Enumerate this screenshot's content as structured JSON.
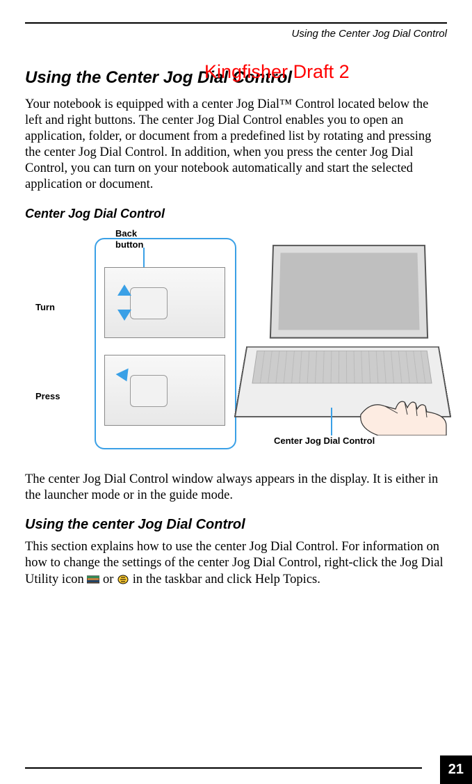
{
  "running_head": "Using the Center Jog Dial Control",
  "watermark": "Kingfisher Draft 2",
  "h1": "Using the Center Jog Dial Control",
  "p1": "Your notebook is equipped with a center Jog Dial™ Control located below the left and right buttons. The center Jog Dial Control enables you to open an application, folder, or document from a predefined list by rotating and pressing the center Jog Dial Control. In addition, when you press the center Jog Dial Control, you can turn on your notebook automatically and start the selected application or document.",
  "figcap": "Center Jog Dial Control",
  "labels": {
    "back": "Back\nbutton",
    "turn": "Turn",
    "press": "Press",
    "centerjog": "Center Jog Dial Control"
  },
  "p2": "The center Jog Dial Control window always appears in the display. It is either in the launcher mode or in the guide mode.",
  "h2": "Using the center Jog Dial Control",
  "p3a": "This section explains how to use the center Jog Dial Control. For information on how to change the settings of the center Jog Dial Control, right-click the Jog Dial Utility icon ",
  "p3mid": " or ",
  "p3b": " in the taskbar and click Help Topics.",
  "page_number": "21"
}
